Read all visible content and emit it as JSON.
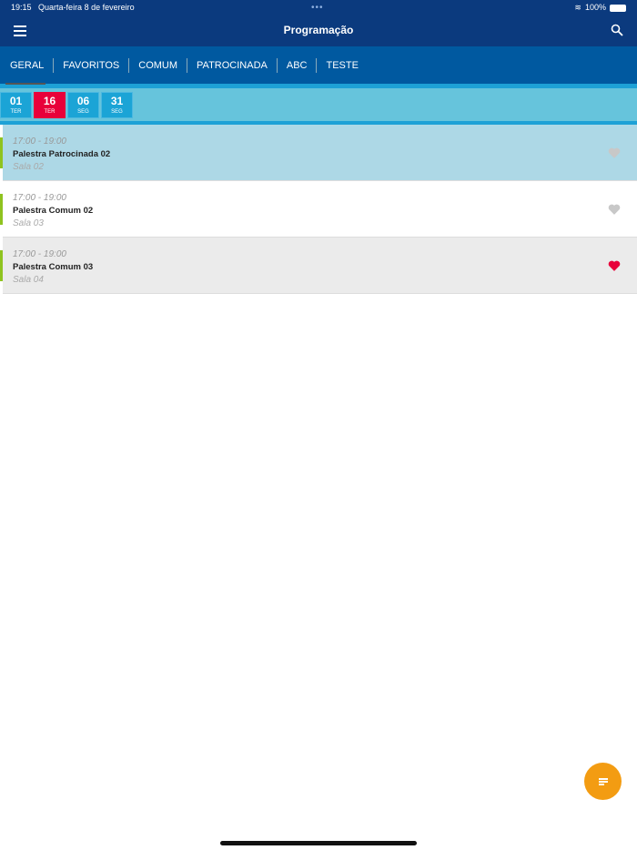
{
  "status": {
    "time": "19:15",
    "date": "Quarta-feira 8 de fevereiro",
    "battery": "100%"
  },
  "header": {
    "title": "Programação"
  },
  "tabs": [
    "GERAL",
    "FAVORITOS",
    "COMUM",
    "PATROCINADA",
    "ABC",
    "TESTE"
  ],
  "dates": [
    {
      "num": "01",
      "day": "TER"
    },
    {
      "num": "16",
      "day": "TER",
      "selected": true
    },
    {
      "num": "06",
      "day": "SEG"
    },
    {
      "num": "31",
      "day": "SEG"
    }
  ],
  "items": [
    {
      "time": "17:00 - 19:00",
      "name": "Palestra Patrocinada 02",
      "room": "Sala 02",
      "favorite": false
    },
    {
      "time": "17:00 - 19:00",
      "name": "Palestra Comum 02",
      "room": "Sala 03",
      "favorite": false
    },
    {
      "time": "17:00 - 19:00",
      "name": "Palestra Comum 03",
      "room": "Sala 04",
      "favorite": true
    }
  ],
  "colors": {
    "header": "#0b3a7e",
    "tabs": "#0059a0",
    "selected_date": "#e8003a",
    "fab": "#f39c12",
    "favorite": "#e8003a"
  }
}
